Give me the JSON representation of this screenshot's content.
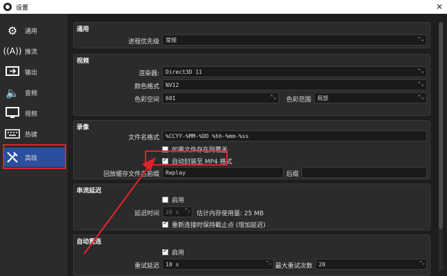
{
  "window": {
    "title": "设置",
    "close": "✕"
  },
  "sidebar": {
    "items": [
      {
        "label": "通用",
        "icon": "gear-icon"
      },
      {
        "label": "推流",
        "icon": "antenna-icon"
      },
      {
        "label": "输出",
        "icon": "output-icon"
      },
      {
        "label": "音频",
        "icon": "speaker-icon"
      },
      {
        "label": "视频",
        "icon": "monitor-icon"
      },
      {
        "label": "热键",
        "icon": "keyboard-icon"
      },
      {
        "label": "高级",
        "icon": "tools-icon"
      }
    ],
    "active": "高级"
  },
  "general": {
    "title": "通用",
    "priority_label": "进程优先级",
    "priority_value": "常规"
  },
  "video": {
    "title": "视频",
    "renderer_label": "渲染器:",
    "renderer_value": "Direct3D 11",
    "color_format_label": "颜色格式",
    "color_format_value": "NV12",
    "color_space_label": "色彩空间",
    "color_space_value": "601",
    "color_range_label": "色彩范围",
    "color_range_value": "局部"
  },
  "recording": {
    "title": "录像",
    "filename_label": "文件名格式",
    "filename_value": "%CCYY-%MM-%DD %hh-%mm-%ss",
    "overwrite_label": "如果文件存在则覆盖",
    "overwrite_checked": false,
    "remux_label": "自动封装至 MP4 格式",
    "remux_checked": true,
    "replay_label": "回放缓存文件名前缀",
    "replay_value": "Replay",
    "suffix_label": "后缀",
    "suffix_value": ""
  },
  "stream_delay": {
    "title": "串流延迟",
    "enable_label": "启用",
    "enable_checked": false,
    "duration_label": "延迟时间",
    "duration_value": "20 s",
    "memory_label": "估计内存使用量: 25 MB",
    "preserve_label": "重新连接时保持截止点 (增加延迟)",
    "preserve_checked": true
  },
  "reconnect": {
    "title": "自动重连",
    "enable_label": "启用",
    "enable_checked": true,
    "retry_delay_label": "重试延迟",
    "retry_delay_value": "10 s",
    "max_retries_label": "最大重试次数",
    "max_retries_value": "20"
  },
  "colors": {
    "highlight": "#e0232a",
    "active_nav": "#2a4f9e"
  }
}
